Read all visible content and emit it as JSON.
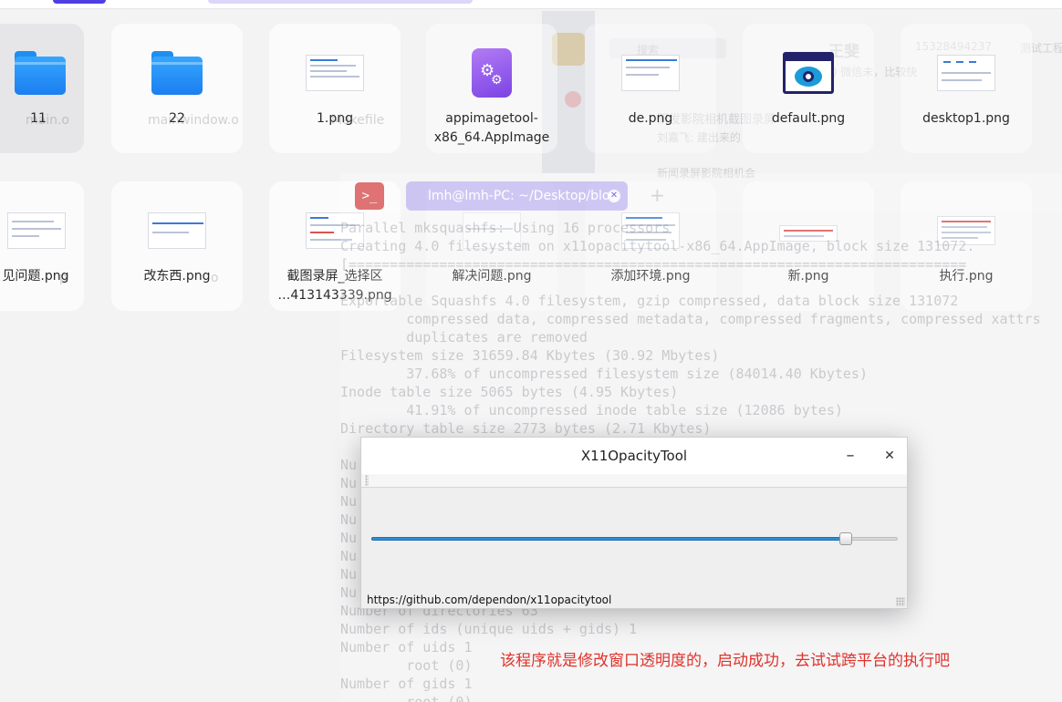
{
  "colors": {
    "accent": "#2f8fd6",
    "caption": "#e0322a",
    "folder": "#1c7ff0"
  },
  "files": [
    {
      "name": "11",
      "ghost": "main.o",
      "icon": "folder-icon"
    },
    {
      "name": "22",
      "ghost": "mainwindow.o",
      "icon": "folder-icon"
    },
    {
      "name": "1.png",
      "ghost": "Makefile",
      "icon": "image-thumbnail"
    },
    {
      "name": "appimagetool-\nx86_64.AppImage",
      "icon": "appimage-gear-icon"
    },
    {
      "name": "de.png",
      "icon": "image-thumbnail"
    },
    {
      "name": "default.png",
      "icon": "eye-icon"
    },
    {
      "name": "desktop1.png",
      "icon": "image-thumbnail"
    },
    {
      "name": "见问题.png",
      "ghost": "p",
      "icon": "image-thumbnail"
    },
    {
      "name": "改东西.png",
      "ghost": "o",
      "icon": "image-thumbnail"
    },
    {
      "name": "截图录屏_选择区\n…413143339.png",
      "icon": "image-thumbnail"
    },
    {
      "name": "解决问题.png",
      "icon": "image-thumbnail"
    },
    {
      "name": "添加环境.png",
      "icon": "image-thumbnail"
    },
    {
      "name": "新.png",
      "icon": "image-thumbnail"
    },
    {
      "name": "执行.png",
      "icon": "image-thumbnail"
    }
  ],
  "chat": {
    "search_placeholder": "搜索",
    "contact_name": "王斐",
    "contact_status": "Q 微信未，比较快",
    "phone": "15328494237",
    "group": "测试工程",
    "msg1": "研发影院相机截图录屏",
    "msg1_sub": "刘嘉飞: 建出来的",
    "msg2": "新闻录屏影院相机会"
  },
  "terminal": {
    "tab_title": "lmh@lmh-PC: ~/Desktop/blog",
    "lines": [
      "Parallel mksquashfs: Using 16 processors",
      "Creating 4.0 filesystem on x11opacitytool-x86_64.AppImage, block size 131072.",
      "[===========================================================================",
      "Exportable Squashfs 4.0 filesystem, gzip compressed, data block size 131072",
      "        compressed data, compressed metadata, compressed fragments, compressed xattrs",
      "        duplicates are removed",
      "Filesystem size 31659.84 Kbytes (30.92 Mbytes)",
      "        37.68% of uncompressed filesystem size (84014.40 Kbytes)",
      "Inode table size 5065 bytes (4.95 Kbytes)",
      "        41.91% of uncompressed inode table size (12086 bytes)",
      "Directory table size 2773 bytes (2.71 Kbytes)",
      "",
      "Nu",
      "Nu",
      "Nu",
      "Nu",
      "Nu",
      "Nu",
      "Nu",
      "Nu",
      "Number of directories 63",
      "Number of ids (unique uids + gids) 1",
      "Number of uids 1",
      "        root (0)",
      "Number of gids 1",
      "        root (0)"
    ]
  },
  "app_window": {
    "title": "X11OpacityTool",
    "minimize_glyph": "–",
    "close_glyph": "✕",
    "slider_value": 0.902,
    "status_url": "https://github.com/dependon/x11opacitytool"
  },
  "caption": "该程序就是修改窗口透明度的，启动成功，去试试跨平台的执行吧"
}
